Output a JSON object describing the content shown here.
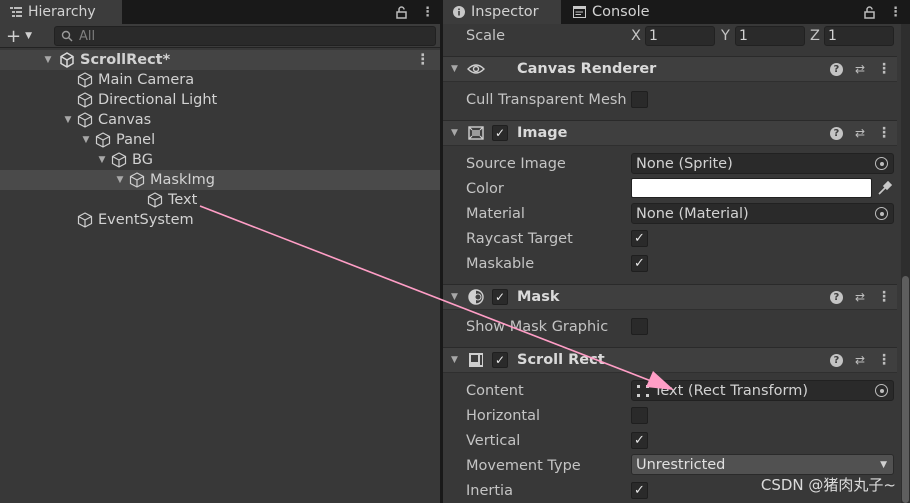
{
  "hierarchy": {
    "tab_label": "Hierarchy",
    "search_placeholder": "All",
    "scene_name": "ScrollRect*",
    "items": [
      {
        "label": "Main Camera"
      },
      {
        "label": "Directional Light"
      },
      {
        "label": "Canvas"
      },
      {
        "label": "Panel"
      },
      {
        "label": "BG"
      },
      {
        "label": "MaskImg"
      },
      {
        "label": "Text"
      },
      {
        "label": "EventSystem"
      }
    ]
  },
  "inspector": {
    "tabs": [
      {
        "label": "Inspector"
      },
      {
        "label": "Console"
      }
    ],
    "transform": {
      "scale_label": "Scale",
      "x_label": "X",
      "x": "1",
      "y_label": "Y",
      "y": "1",
      "z_label": "Z",
      "z": "1"
    },
    "canvas_renderer": {
      "title": "Canvas Renderer",
      "cull_label": "Cull Transparent Mesh",
      "cull_checked": false
    },
    "image": {
      "title": "Image",
      "source_image_label": "Source Image",
      "source_image_value": "None (Sprite)",
      "color_label": "Color",
      "color_value": "#ffffff",
      "material_label": "Material",
      "material_value": "None (Material)",
      "raycast_label": "Raycast Target",
      "raycast_checked": true,
      "maskable_label": "Maskable",
      "maskable_checked": true
    },
    "mask": {
      "title": "Mask",
      "show_graphic_label": "Show Mask Graphic",
      "show_graphic_checked": false
    },
    "scroll_rect": {
      "title": "Scroll Rect",
      "content_label": "Content",
      "content_value": "Text (Rect Transform)",
      "horizontal_label": "Horizontal",
      "horizontal_checked": false,
      "vertical_label": "Vertical",
      "vertical_checked": true,
      "movement_type_label": "Movement Type",
      "movement_type_value": "Unrestricted",
      "inertia_label": "Inertia",
      "inertia_checked": true
    }
  },
  "colors": {
    "panel_bg": "#383838",
    "annotation_arrow": "#ff9ec6"
  },
  "watermark": "CSDN @猪肉丸子~"
}
